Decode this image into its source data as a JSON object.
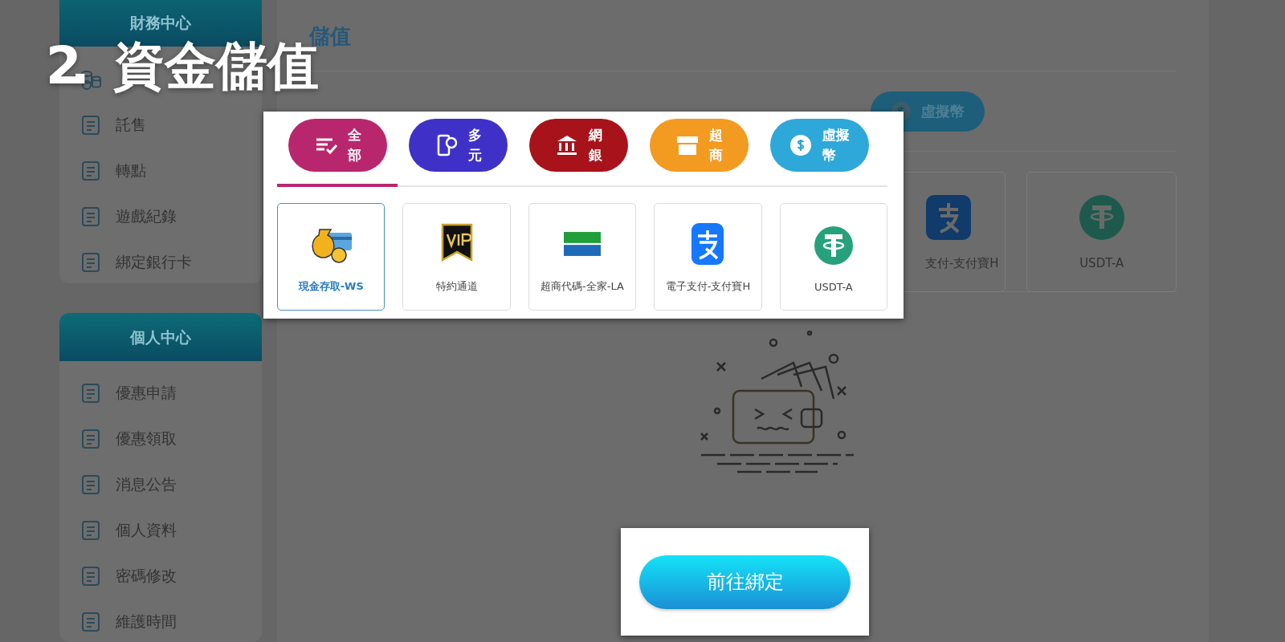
{
  "heading": {
    "number": "2.",
    "title": "資金儲值"
  },
  "sidebar": [
    {
      "title": "財務中心",
      "items": [
        {
          "label": "託售"
        },
        {
          "label": "轉點"
        },
        {
          "label": "遊戲紀錄"
        },
        {
          "label": "綁定銀行卡"
        }
      ]
    },
    {
      "title": "個人中心",
      "items": [
        {
          "label": "優惠申請"
        },
        {
          "label": "優惠領取"
        },
        {
          "label": "消息公告"
        },
        {
          "label": "個人資料"
        },
        {
          "label": "密碼修改"
        },
        {
          "label": "維護時間"
        }
      ]
    }
  ],
  "main": {
    "title": "儲值",
    "tabs": [
      {
        "label": "虛擬幣"
      }
    ],
    "cards": [
      {
        "label": "支付-支付寶H"
      },
      {
        "label": "USDT-A"
      }
    ]
  },
  "callout": {
    "tabs": [
      {
        "label": "全部",
        "color": "#b8276e",
        "selected": true
      },
      {
        "label": "多元",
        "color": "#3f31c8",
        "selected": false
      },
      {
        "label": "網銀",
        "color": "#a8121a",
        "selected": false
      },
      {
        "label": "超商",
        "color": "#f39a21",
        "selected": false
      },
      {
        "label": "虛擬幣",
        "color": "#2ea8d8",
        "selected": false
      }
    ],
    "channels": [
      {
        "label": "現金存取-WS",
        "selected": true
      },
      {
        "label": "特約通道",
        "selected": false
      },
      {
        "label": "超商代碼-全家-LA",
        "selected": false
      },
      {
        "label": "電子支付-支付寶H",
        "selected": false
      },
      {
        "label": "USDT-A",
        "selected": false
      }
    ],
    "button": "前往綁定"
  }
}
